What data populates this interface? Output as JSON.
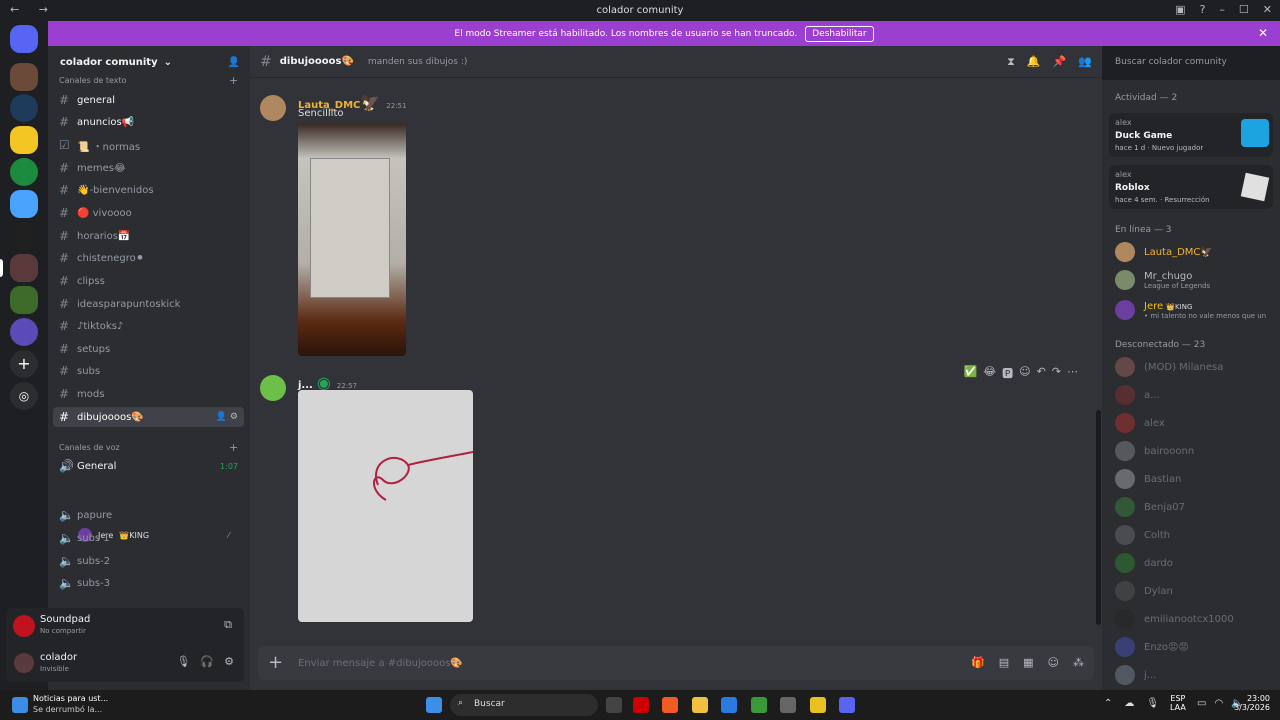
{
  "window": {
    "title": "colador comunity",
    "nav": "← →"
  },
  "banner": {
    "text": "El modo Streamer está habilitado. Los nombres de usuario se han truncado.",
    "button": "Deshabilitar",
    "close": "✕"
  },
  "server": {
    "name": "colador comunity"
  },
  "categories": {
    "text": "Canales de texto",
    "voice": "Canales de voz"
  },
  "text_channels": [
    {
      "label": "general",
      "emoji": ""
    },
    {
      "label": "anuncios",
      "emoji": "📢"
    },
    {
      "label": "📜 ・normas",
      "emoji": ""
    },
    {
      "label": "memes",
      "emoji": "😂"
    },
    {
      "label": "👋-bienvenidos",
      "emoji": ""
    },
    {
      "label": "🔴 vivoooo",
      "emoji": ""
    },
    {
      "label": "horarios",
      "emoji": "📅"
    },
    {
      "label": "chistenegro",
      "emoji": "⚫"
    },
    {
      "label": "clipss",
      "emoji": ""
    },
    {
      "label": "ideasparapuntoskick",
      "emoji": ""
    },
    {
      "label": "♪tiktoks♪",
      "emoji": ""
    },
    {
      "label": "setups",
      "emoji": ""
    },
    {
      "label": "subs",
      "emoji": ""
    },
    {
      "label": "mods",
      "emoji": ""
    },
    {
      "label": "dibujoooos",
      "emoji": "🎨"
    }
  ],
  "voice_channels": [
    {
      "label": "General",
      "time": "1:07"
    },
    {
      "label": "papure"
    },
    {
      "label": "subs 1"
    },
    {
      "label": "subs-2"
    },
    {
      "label": "subs-3"
    }
  ],
  "voice_user": {
    "name": "Jere",
    "badge": "👑KING"
  },
  "soundpad": {
    "name": "Soundpad",
    "status": "No compartir"
  },
  "me": {
    "name": "colador",
    "status": "Invisible"
  },
  "channel": {
    "name": "dibujoooos🎨",
    "topic": "manden sus dibujos :)"
  },
  "search": {
    "placeholder": "Buscar colador comunity"
  },
  "messages": [
    {
      "user": "Lauta_DMC",
      "emoji": "🦅",
      "time": "22:51",
      "text": "Sencillito"
    },
    {
      "user": "j...",
      "time": "22:57"
    }
  ],
  "composer": {
    "placeholder": "Enviar mensaje a #dibujoooos🎨"
  },
  "members": {
    "activity_header": "Actividad — 2",
    "activities": [
      {
        "user": "alex",
        "game": "Duck Game",
        "ago": "hace 1 d",
        "tag": "Nuevo jugador"
      },
      {
        "user": "alex",
        "game": "Roblox",
        "ago": "hace 4 sem.",
        "tag": "Resurrección"
      }
    ],
    "online_header": "En línea — 3",
    "online": [
      {
        "name": "Lauta_DMC🦅",
        "sub": ""
      },
      {
        "name": "Mr_chugo",
        "sub": "League of Legends"
      },
      {
        "name": "Jere",
        "sub": "• mi talento no vale menos que un",
        "badge": "👑KING"
      }
    ],
    "offline_header": "Desconectado — 23",
    "offline": [
      "(MOD) Milanesa",
      "a...",
      "alex",
      "bairooonn",
      "Bastian",
      "Benja07",
      "Colth",
      "dardo",
      "Dylan",
      "emilianootcx1000",
      "Enzo😡😡",
      "j..."
    ]
  },
  "taskbar": {
    "news_title": "Noticias para ust...",
    "news_sub": "Se derrumbó la...",
    "search": "Buscar",
    "lang": "ESP",
    "region": "LAA",
    "time": "23:00",
    "date": "3/3/2026"
  }
}
